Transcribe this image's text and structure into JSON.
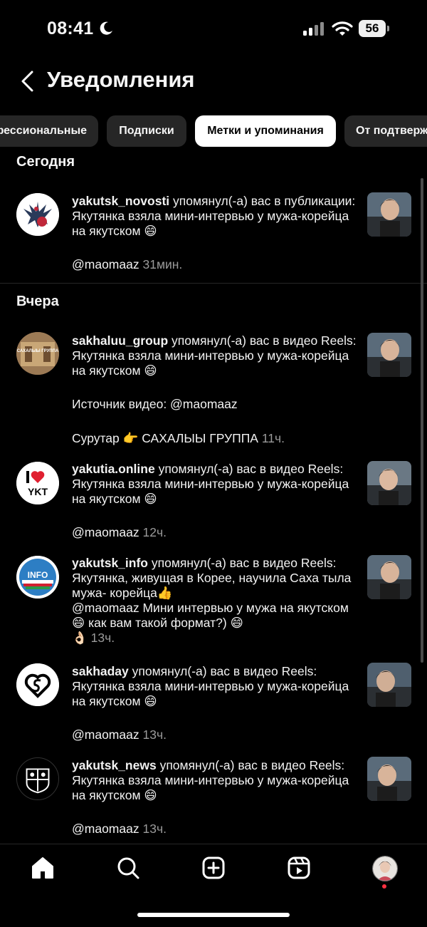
{
  "status": {
    "time": "08:41",
    "battery": "56"
  },
  "header": {
    "title": "Уведомления"
  },
  "filters": [
    {
      "label": "Профессиональные"
    },
    {
      "label": "Подписки"
    },
    {
      "label": "Метки и упоминания"
    },
    {
      "label": "От подтвержденных"
    }
  ],
  "sections": {
    "today": "Сегодня",
    "yesterday": "Вчера"
  },
  "notifications": [
    {
      "user": "yakutsk_novosti",
      "text": "упомянул(-а) вас в публикации: Якутянка взяла мини-интервью у мужа-корейца на якутском 😄",
      "line2": "@maomaaz",
      "time": "31мин."
    },
    {
      "user": "sakhaluu_group",
      "text": "упомянул(-а) вас в видео Reels: Якутянка взяла мини-интервью у мужа-корейца на якутском 😄",
      "line2": "Источник видео: @maomaaz",
      "line3": "Сурутар 👉 САХАЛЫЫ ГРУППА",
      "time": "11ч."
    },
    {
      "user": "yakutia.online",
      "text": "упомянул(-а) вас в видео Reels: Якутянка взяла мини-интервью у мужа-корейца на якутском 😄",
      "line2": "@maomaaz",
      "time": "12ч."
    },
    {
      "user": "yakutsk_info",
      "text": "упомянул(-а) вас в видео Reels: Якутянка, живущая в Корее, научила Саха тыла мужа- корейца👍",
      "line2": "@maomaaz Мини интервью у мужа на якутском 😄 как вам такой формат?) 😄",
      "line3": "👌🏻",
      "time": "13ч."
    },
    {
      "user": "sakhaday",
      "text": "упомянул(-а) вас в видео Reels: Якутянка взяла мини-интервью у мужа-корейца на якутском 😄",
      "line2": "@maomaaz",
      "time": "13ч."
    },
    {
      "user": "yakutsk_news",
      "text": "упомянул(-а) вас в видео Reels: Якутянка взяла мини-интервью у мужа-корейца на якутском 😄",
      "line2": "@maomaaz",
      "time": "13ч."
    }
  ],
  "avatar_labels": {
    "sakhaluu": "САХАЛЫЫ ГРУППА",
    "ykt": "YKT",
    "info": "INFO"
  },
  "icons": [
    "home-icon",
    "search-icon",
    "create-icon",
    "reels-icon",
    "profile-icon"
  ],
  "colors": {
    "background": "#000000",
    "muted": "#9a9a9a",
    "chip": "#262626",
    "chip_active": "#ffffff"
  }
}
